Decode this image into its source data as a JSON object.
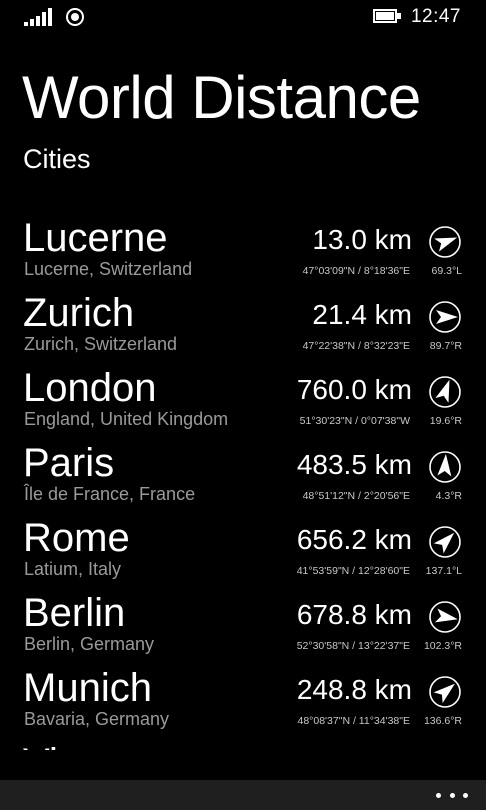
{
  "status_bar": {
    "signal_icon": "signal-strength-icon",
    "wifi_icon": "location-icon",
    "battery_icon": "battery-charging-icon",
    "time": "12:47"
  },
  "app": {
    "title": "World Distance",
    "page_title": "Cities"
  },
  "cities": [
    {
      "name": "Lucerne",
      "region": "Lucerne, Switzerland",
      "distance": "13.0 km",
      "coords": "47°03'09\"N / 8°18'36\"E",
      "bearing": "69.3°L",
      "heading_deg": 70
    },
    {
      "name": "Zurich",
      "region": "Zurich, Switzerland",
      "distance": "21.4 km",
      "coords": "47°22'38\"N / 8°32'23\"E",
      "bearing": "89.7°R",
      "heading_deg": 90
    },
    {
      "name": "London",
      "region": "England, United Kingdom",
      "distance": "760.0 km",
      "coords": "51°30'23\"N / 0°07'38\"W",
      "bearing": "19.6°R",
      "heading_deg": 20
    },
    {
      "name": "Paris",
      "region": "Île de France, France",
      "distance": "483.5 km",
      "coords": "48°51'12\"N / 2°20'56\"E",
      "bearing": "4.3°R",
      "heading_deg": 4
    },
    {
      "name": "Rome",
      "region": "Latium, Italy",
      "distance": "656.2 km",
      "coords": "41°53'59\"N / 12°28'60\"E",
      "bearing": "137.1°L",
      "heading_deg": 45
    },
    {
      "name": "Berlin",
      "region": "Berlin, Germany",
      "distance": "678.8 km",
      "coords": "52°30'58\"N / 13°22'37\"E",
      "bearing": "102.3°R",
      "heading_deg": 100
    },
    {
      "name": "Munich",
      "region": "Bavaria, Germany",
      "distance": "248.8 km",
      "coords": "48°08'37\"N / 11°34'38\"E",
      "bearing": "136.6°R",
      "heading_deg": 50
    },
    {
      "name": "Vi",
      "region": "",
      "distance": "",
      "coords": "",
      "bearing": "",
      "heading_deg": 0
    }
  ],
  "app_bar": {
    "more_icon": "ellipsis-icon"
  },
  "colors": {
    "background": "#000000",
    "text": "#ffffff",
    "secondary_text": "#9a9a9a",
    "app_bar": "#1f1f1f"
  }
}
